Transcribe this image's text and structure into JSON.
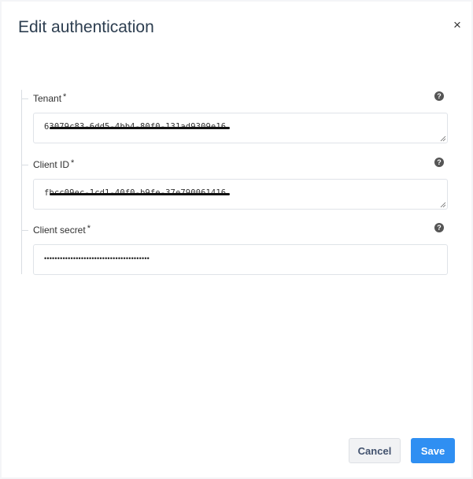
{
  "dialog": {
    "title": "Edit authentication",
    "close_glyph": "×"
  },
  "fields": [
    {
      "label": "Tenant",
      "required_mark": "*",
      "value": "63079c83-6dd5-4bb4-80f0-131ad9309e16",
      "redacted": true,
      "help_icon": "question-circle-icon"
    },
    {
      "label": "Client ID",
      "required_mark": "*",
      "value": "fbcc09ec-1cd1-40f0-b9fe-37e790061416",
      "redacted": true,
      "help_icon": "question-circle-icon"
    },
    {
      "label": "Client secret",
      "required_mark": "*",
      "value": "••••••••••••••••••••••••••••••••••••••••",
      "redacted": false,
      "help_icon": "question-circle-icon"
    }
  ],
  "footer": {
    "cancel_label": "Cancel",
    "save_label": "Save"
  },
  "colors": {
    "primary": "#2f8ff2",
    "title_text": "#2d3e50",
    "help_icon": "#555555"
  }
}
